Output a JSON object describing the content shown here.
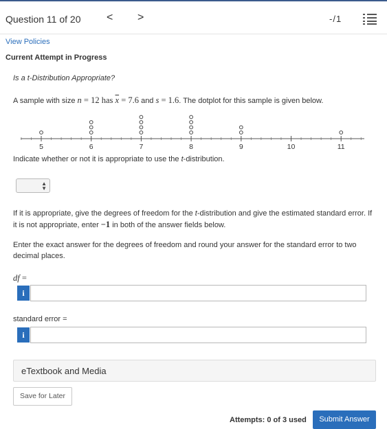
{
  "header": {
    "question_label": "Question 11 of 20",
    "prev_label": "<",
    "next_label": ">",
    "score": "-/1"
  },
  "links": {
    "view_policies": "View Policies"
  },
  "status": {
    "current_attempt": "Current Attempt in Progress"
  },
  "question": {
    "title": "Is a t-Distribution Appropriate?",
    "stmt_a": "A sample with size ",
    "n_var": "n",
    "n_eq": " = 12 has ",
    "xbar_var": "x",
    "xbar_eq": " = 7.6",
    "and": " and ",
    "s_var": "s",
    "s_eq": " = 1.6",
    "stmt_b": ". The dotplot for this sample is given below.",
    "indicate_a": "Indicate whether or not it is appropriate to use the ",
    "indicate_t": "t",
    "indicate_b": "-distribution.",
    "para1_a": "If it is appropriate, give the degrees of freedom for the ",
    "para1_t": "t",
    "para1_b": "-distribution and give the estimated standard error. If it is not appropriate, enter ",
    "para1_neg": "−1",
    "para1_c": " in both of the answer fields below.",
    "para2": "Enter the exact answer for the degrees of freedom and round your answer for the standard error to two decimal places."
  },
  "dotplot": {
    "ticks": [
      "5",
      "6",
      "7",
      "8",
      "9",
      "10",
      "11"
    ],
    "dots": [
      {
        "value": 5,
        "count": 1
      },
      {
        "value": 6,
        "count": 3
      },
      {
        "value": 7,
        "count": 4
      },
      {
        "value": 8,
        "count": 4
      },
      {
        "value": 9,
        "count": 2
      },
      {
        "value": 11,
        "count": 1
      }
    ]
  },
  "form": {
    "select_value": "",
    "df_label": "df",
    "df_eq": " =",
    "info_glyph": "i",
    "df_value": "",
    "se_label": "standard error =",
    "se_value": ""
  },
  "footer": {
    "etextbook": "eTextbook and Media",
    "save_later": "Save for Later",
    "attempts": "Attempts: 0 of 3 used",
    "submit": "Submit Answer"
  },
  "colors": {
    "accent": "#2a6ebb",
    "topbar": "#3a5a8c"
  }
}
